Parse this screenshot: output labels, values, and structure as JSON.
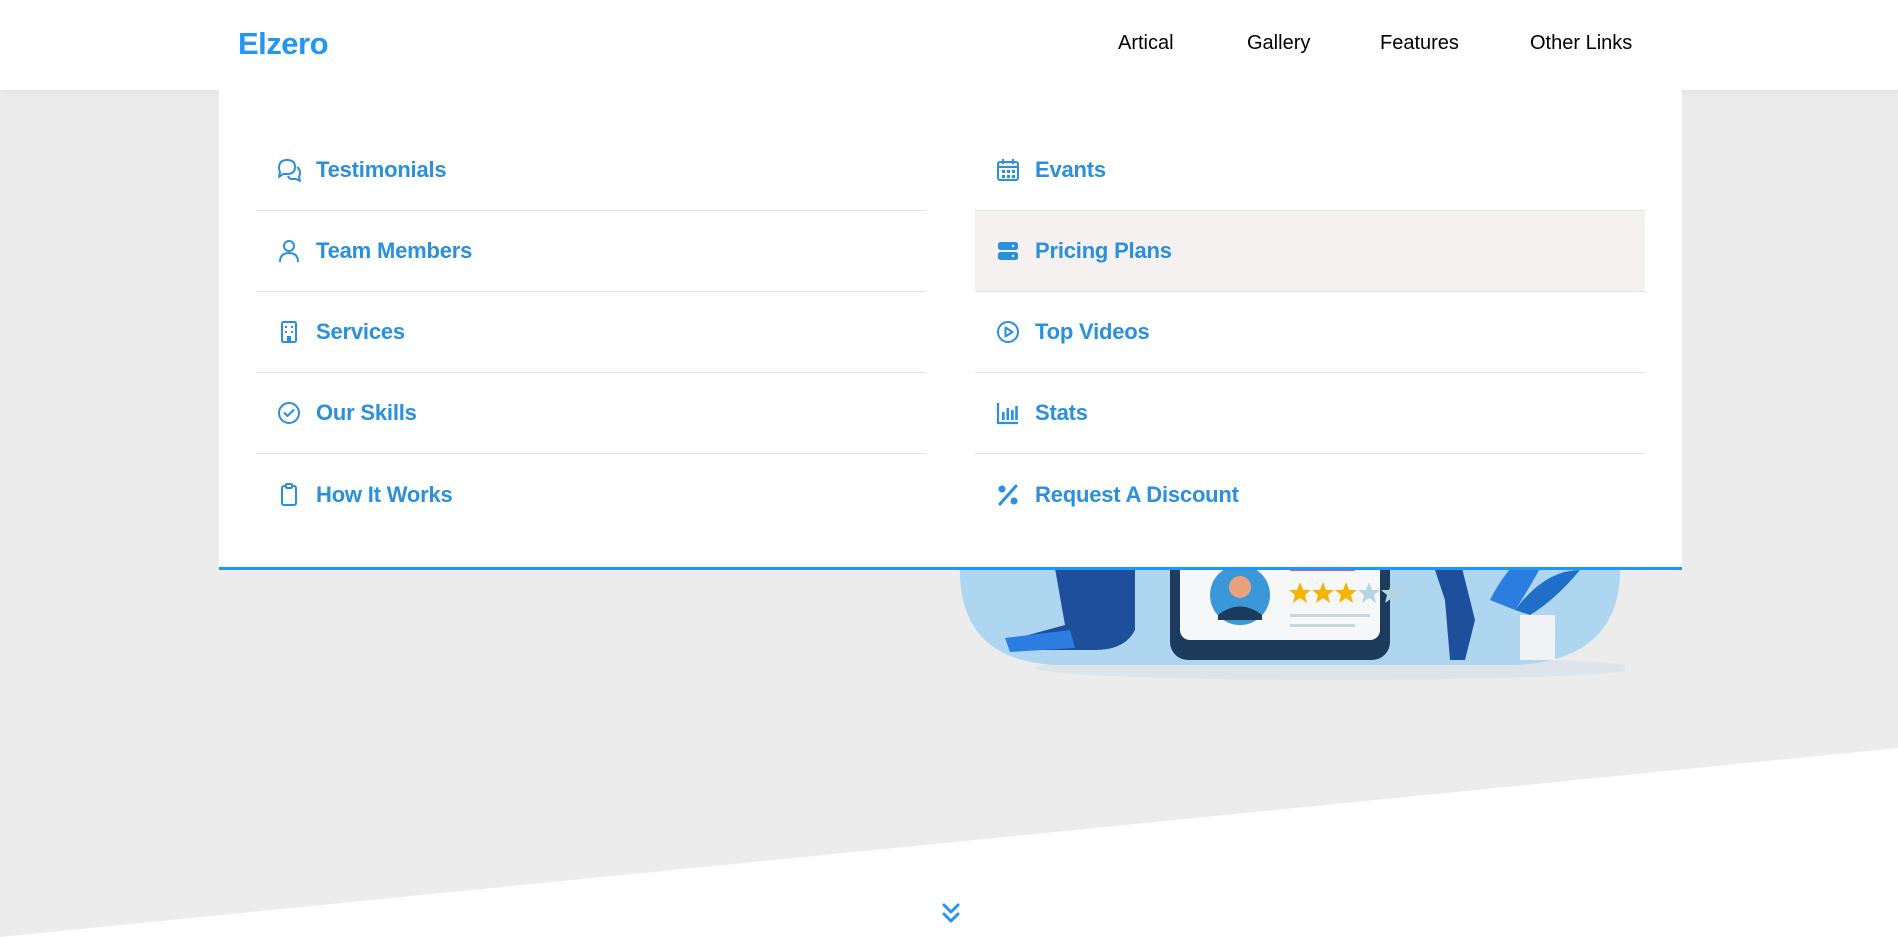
{
  "header": {
    "logo": "Elzero",
    "nav": [
      {
        "label": "Artical"
      },
      {
        "label": "Gallery"
      },
      {
        "label": "Features"
      },
      {
        "label": "Other Links"
      }
    ]
  },
  "mega_menu": {
    "left": [
      {
        "label": "Testimonials",
        "icon": "comments-icon"
      },
      {
        "label": "Team Members",
        "icon": "user-icon"
      },
      {
        "label": "Services",
        "icon": "building-icon"
      },
      {
        "label": "Our Skills",
        "icon": "check-circle-icon"
      },
      {
        "label": "How It Works",
        "icon": "clipboard-icon"
      }
    ],
    "right": [
      {
        "label": "Evants",
        "icon": "calendar-icon"
      },
      {
        "label": "Pricing Plans",
        "icon": "server-icon",
        "active": true
      },
      {
        "label": "Top Videos",
        "icon": "play-circle-icon"
      },
      {
        "label": "Stats",
        "icon": "chart-bar-icon"
      },
      {
        "label": "Request A Discount",
        "icon": "percent-icon"
      }
    ]
  },
  "colors": {
    "accent": "#2196f3",
    "menu_text": "#2a8fdc",
    "active_bg": "#f4f1f0",
    "page_bg": "#ececec"
  }
}
